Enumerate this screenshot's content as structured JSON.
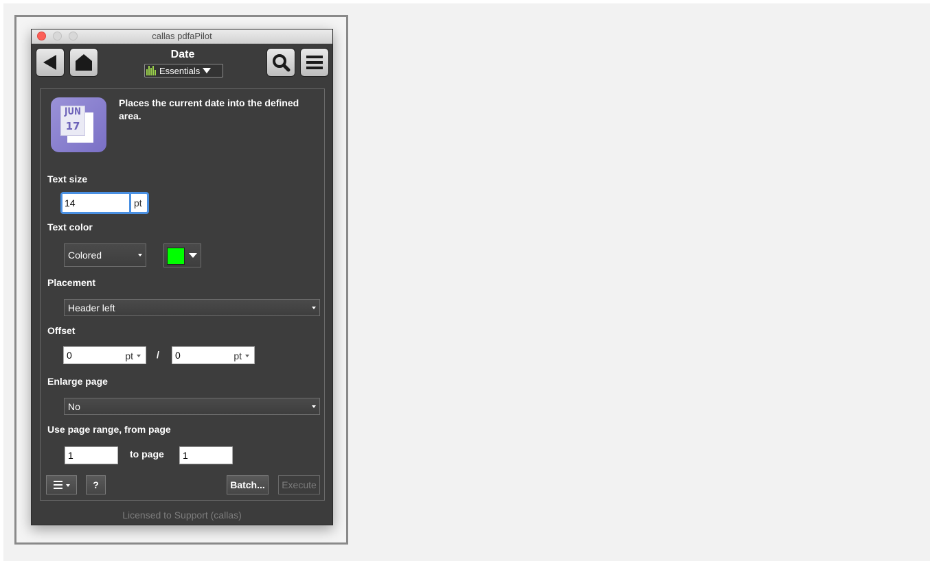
{
  "window": {
    "title": "callas pdfaPilot"
  },
  "header": {
    "title": "Date",
    "workspace": "Essentials"
  },
  "description": "Places the current date into the defined area.",
  "icon": {
    "month": "JUN",
    "day": "17"
  },
  "text_size": {
    "label": "Text size",
    "value": "14",
    "unit": "pt"
  },
  "text_color": {
    "label": "Text color",
    "mode": "Colored",
    "color": "#00ff00"
  },
  "placement": {
    "label": "Placement",
    "value": "Header left"
  },
  "offset": {
    "label": "Offset",
    "x_value": "0",
    "x_unit": "pt",
    "separator": "/",
    "y_value": "0",
    "y_unit": "pt"
  },
  "enlarge_page": {
    "label": "Enlarge page",
    "value": "No"
  },
  "page_range": {
    "label": "Use page range, from page",
    "from": "1",
    "to_label": "to page",
    "to": "1"
  },
  "bottom_bar": {
    "help_label": "?",
    "batch_label": "Batch...",
    "execute_label": "Execute"
  },
  "footer": {
    "license": "Licensed to Support (callas)"
  },
  "colors": {
    "accent": "#4a90e2",
    "panel": "#3c3c3c",
    "swatch": "#00ff00"
  }
}
